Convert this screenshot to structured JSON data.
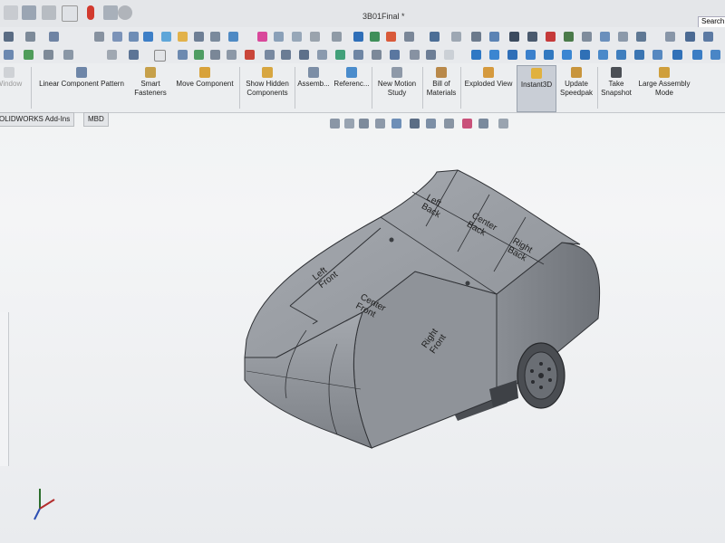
{
  "window": {
    "title": "3B01Final *",
    "search_label": "Search"
  },
  "command_manager": {
    "items": [
      {
        "label": "Window",
        "icon": "component-window-icon"
      },
      {
        "label": "Linear Component Pattern",
        "icon": "linear-pattern-icon"
      },
      {
        "label": "Smart Fasteners",
        "icon": "fastener-icon"
      },
      {
        "label": "Move Component",
        "icon": "move-component-icon"
      },
      {
        "label": "Show Hidden Components",
        "icon": "show-hidden-icon"
      },
      {
        "label": "Assemb...",
        "icon": "assembly-features-icon"
      },
      {
        "label": "Referenc...",
        "icon": "reference-geometry-icon"
      },
      {
        "label": "New Motion Study",
        "icon": "motion-study-icon"
      },
      {
        "label": "Bill of Materials",
        "icon": "bom-icon"
      },
      {
        "label": "Exploded View",
        "icon": "exploded-view-icon"
      },
      {
        "label": "Instant3D",
        "icon": "instant3d-icon",
        "active": true
      },
      {
        "label": "Update Speedpak",
        "icon": "speedpak-icon"
      },
      {
        "label": "Take Snapshot",
        "icon": "camera-icon"
      },
      {
        "label": "Large Assembly Mode",
        "icon": "large-assembly-icon"
      }
    ]
  },
  "tabs": [
    {
      "label": "OLIDWORKS Add-Ins"
    },
    {
      "label": "MBD"
    }
  ],
  "model": {
    "faces": [
      "Left Front",
      "Left Back",
      "Center Back",
      "Right Back",
      "Center Front",
      "Right Front"
    ]
  },
  "triad": {
    "label": "triad"
  },
  "colors": {
    "body": "#8c9096",
    "body_top": "#9fa3a9",
    "wheel": "#5b5e63",
    "active_button": "#c9ced6"
  }
}
